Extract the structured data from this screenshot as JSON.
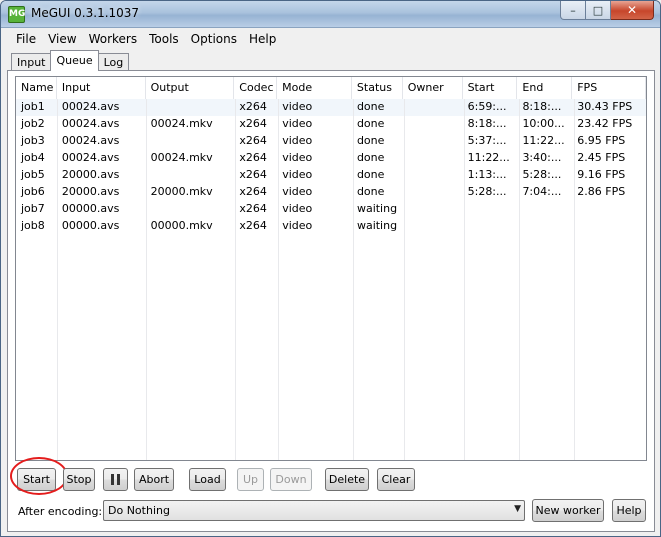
{
  "window": {
    "title": "MeGUI 0.3.1.1037",
    "icon_text": "MG"
  },
  "titlebar_buttons": {
    "minimize": "–",
    "maximize": "□",
    "close": "✕"
  },
  "menu": [
    "File",
    "View",
    "Workers",
    "Tools",
    "Options",
    "Help"
  ],
  "tabs": [
    {
      "label": "Input",
      "active": false
    },
    {
      "label": "Queue",
      "active": true
    },
    {
      "label": "Log",
      "active": false
    }
  ],
  "queue": {
    "columns": [
      "Name",
      "Input",
      "Output",
      "Codec",
      "Mode",
      "Status",
      "Owner",
      "Start",
      "End",
      "FPS"
    ],
    "rows": [
      [
        "job1",
        "00024.avs",
        "",
        "x264",
        "video",
        "done",
        "",
        "6:59:...",
        "8:18:...",
        "30.43 FPS"
      ],
      [
        "job2",
        "00024.avs",
        "00024.mkv",
        "x264",
        "video",
        "done",
        "",
        "8:18:...",
        "10:00...",
        "23.42 FPS"
      ],
      [
        "job3",
        "00024.avs",
        "",
        "x264",
        "video",
        "done",
        "",
        "5:37:...",
        "11:22...",
        "6.95 FPS"
      ],
      [
        "job4",
        "00024.avs",
        "00024.mkv",
        "x264",
        "video",
        "done",
        "",
        "11:22...",
        "3:40:...",
        "2.45 FPS"
      ],
      [
        "job5",
        "20000.avs",
        "",
        "x264",
        "video",
        "done",
        "",
        "1:13:...",
        "5:28:...",
        "9.16 FPS"
      ],
      [
        "job6",
        "20000.avs",
        "20000.mkv",
        "x264",
        "video",
        "done",
        "",
        "5:28:...",
        "7:04:...",
        "2.86 FPS"
      ],
      [
        "job7",
        "00000.avs",
        "",
        "x264",
        "video",
        "waiting",
        "",
        "",
        "",
        ""
      ],
      [
        "job8",
        "00000.avs",
        "00000.mkv",
        "x264",
        "video",
        "waiting",
        "",
        "",
        "",
        ""
      ]
    ]
  },
  "buttons": {
    "start": "Start",
    "stop": "Stop",
    "abort": "Abort",
    "load": "Load",
    "up": "Up",
    "down": "Down",
    "delete": "Delete",
    "clear": "Clear",
    "new_worker": "New worker",
    "help": "Help"
  },
  "after_encoding": {
    "label": "After encoding:",
    "value": "Do Nothing"
  },
  "colors": {
    "highlight_ring": "#e41c1c",
    "selected_row": "#f1f6fb"
  }
}
